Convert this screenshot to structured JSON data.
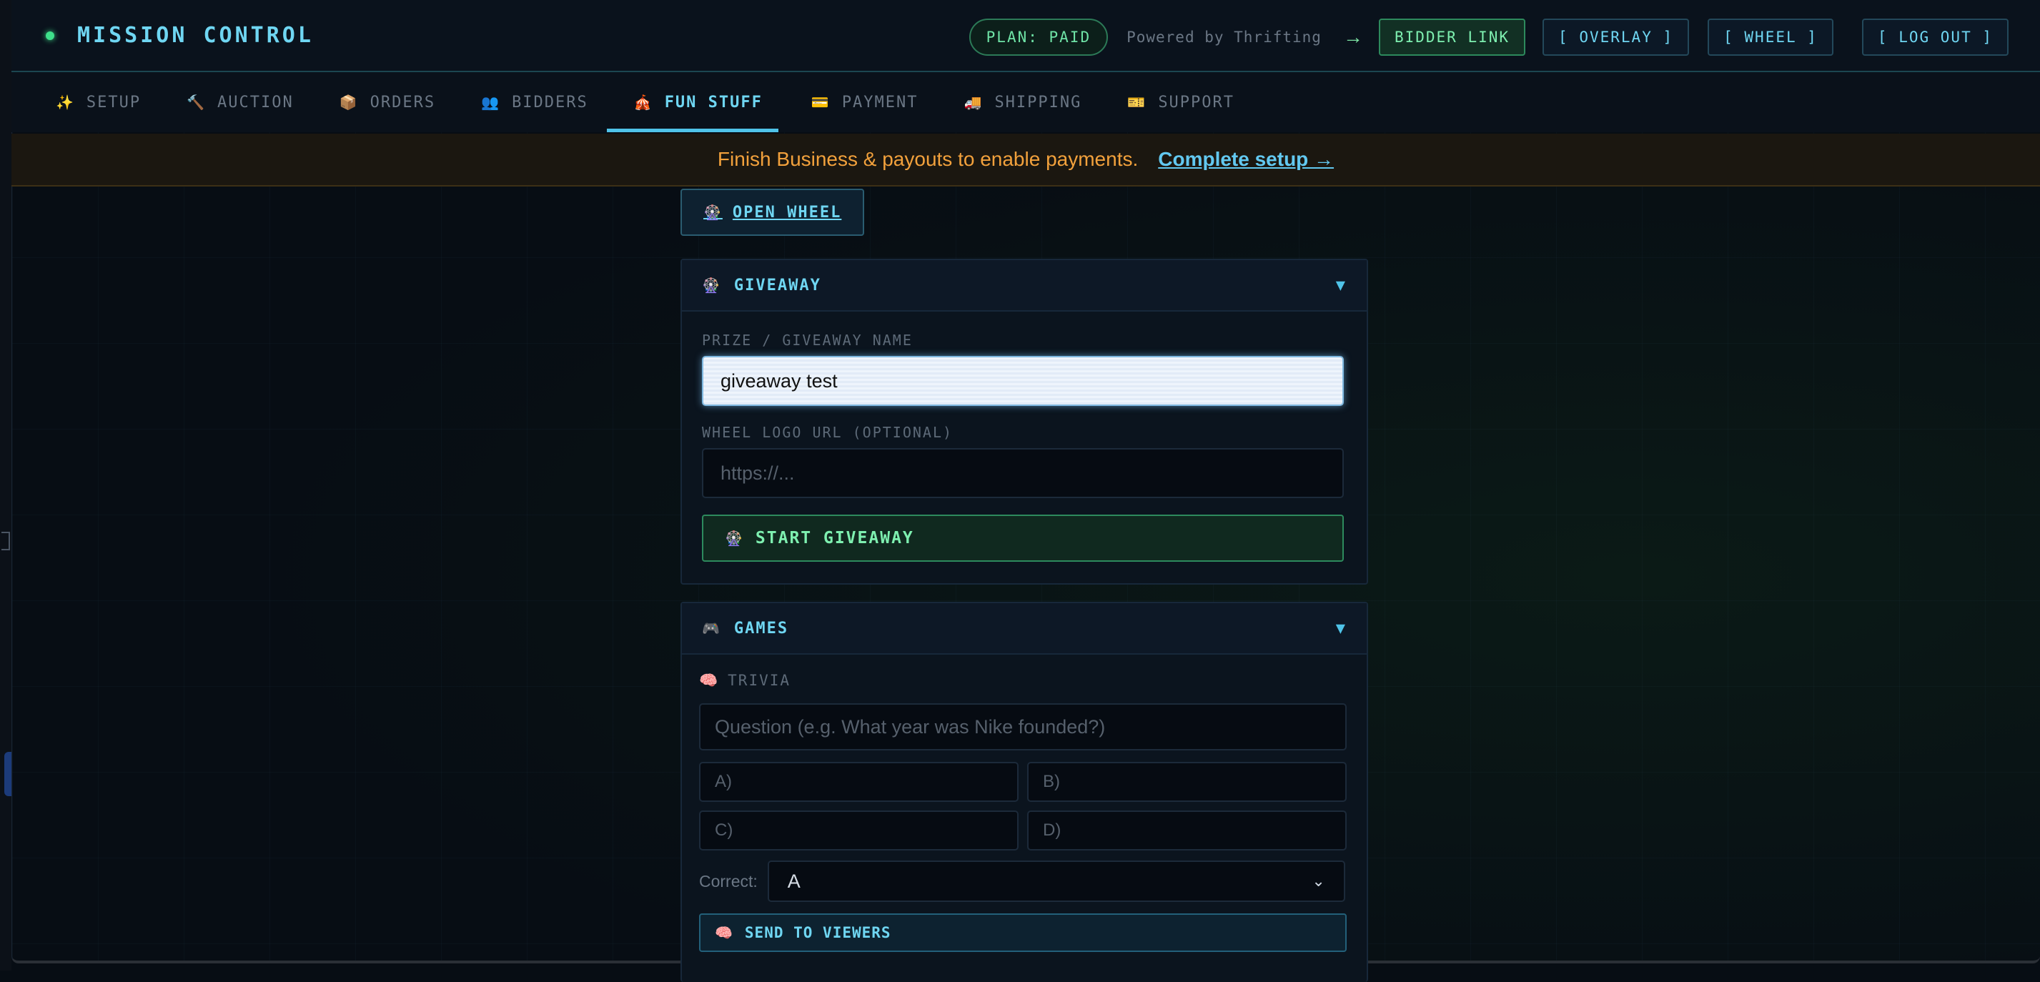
{
  "app": {
    "title": "MISSION CONTROL",
    "plan": "PLAN: PAID",
    "powered_by": "Powered by Thrifting",
    "arrow": "→",
    "buttons": {
      "bidder_link": "BIDDER LINK",
      "overlay": "[ OVERLAY ]",
      "wheel": "[ WHEEL ]",
      "logout": "[ LOG OUT ]"
    }
  },
  "tabs": [
    {
      "icon": "✨",
      "label": "SETUP"
    },
    {
      "icon": "🔨",
      "label": "AUCTION"
    },
    {
      "icon": "📦",
      "label": "ORDERS"
    },
    {
      "icon": "👥",
      "label": "BIDDERS"
    },
    {
      "icon": "🎪",
      "label": "FUN STUFF",
      "active": true
    },
    {
      "icon": "💳",
      "label": "PAYMENT"
    },
    {
      "icon": "🚚",
      "label": "SHIPPING"
    },
    {
      "icon": "🎫",
      "label": "SUPPORT"
    }
  ],
  "banner": {
    "message": "Finish Business & payouts to enable payments.",
    "link": "Complete setup →"
  },
  "open_wheel": {
    "icon": "🎡",
    "label": "OPEN WHEEL"
  },
  "giveaway": {
    "icon": "🎡",
    "title": "GIVEAWAY",
    "chevron": "▼",
    "prize_label": "PRIZE / GIVEAWAY NAME",
    "prize_value": "giveaway test",
    "logo_label": "WHEEL LOGO URL (OPTIONAL)",
    "logo_placeholder": "https://...",
    "start_icon": "🎡",
    "start_button": "START GIVEAWAY"
  },
  "games": {
    "icon": "🎮",
    "title": "GAMES",
    "chevron": "▼",
    "trivia_icon": "🧠",
    "trivia_label": "TRIVIA",
    "question_placeholder": "Question (e.g. What year was Nike founded?)",
    "option_a": "A)",
    "option_b": "B)",
    "option_c": "C)",
    "option_d": "D)",
    "correct_label": "Correct:",
    "correct_value": "A",
    "send_icon": "🧠",
    "send_button": "SEND TO VIEWERS"
  },
  "colors": {
    "accent": "#6fd6f2",
    "success": "#7ef0b0",
    "warning": "#f2a13c",
    "background": "#070d14"
  }
}
